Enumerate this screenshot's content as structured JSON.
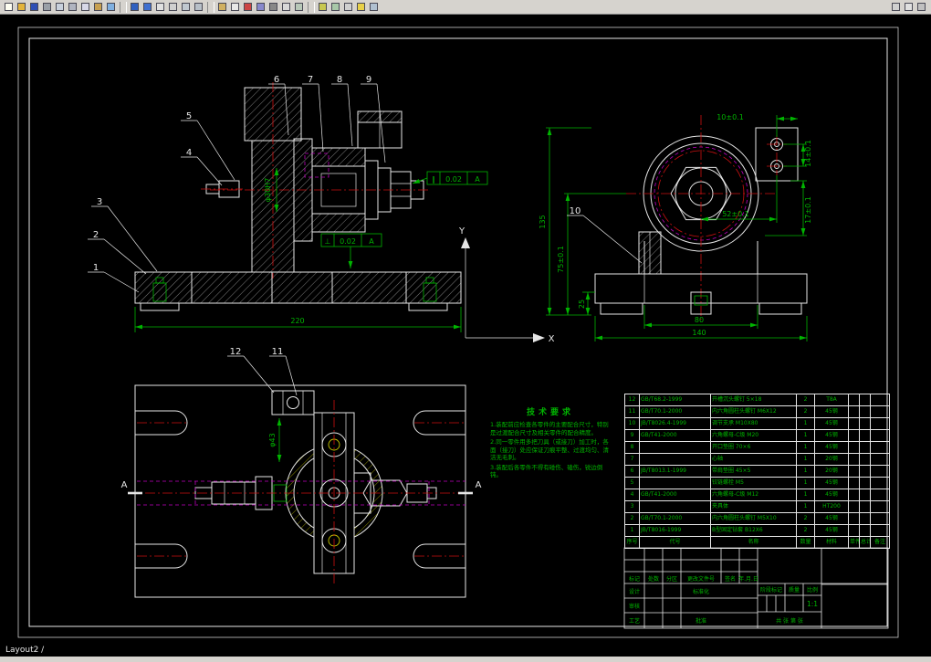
{
  "window": {
    "statusbar_tab": "Layout2 /"
  },
  "toolbar": {
    "groups": [
      {
        "icons": [
          {
            "name": "new-icon",
            "color": "#fdfdf0"
          },
          {
            "name": "open-icon",
            "color": "#e3b43c"
          },
          {
            "name": "save-icon",
            "color": "#2f4fb4"
          },
          {
            "name": "print-icon",
            "color": "#9aa0a8"
          },
          {
            "name": "print-preview-icon",
            "color": "#c8d0dc"
          },
          {
            "name": "cut-icon",
            "color": "#b0b4c0"
          },
          {
            "name": "copy-icon",
            "color": "#d8d8e8"
          },
          {
            "name": "paste-icon",
            "color": "#c8a050"
          },
          {
            "name": "match-properties-icon",
            "color": "#80b0e0"
          }
        ]
      },
      {
        "icons": [
          {
            "name": "undo-icon",
            "color": "#3060c0"
          },
          {
            "name": "redo-icon",
            "color": "#4070d0"
          },
          {
            "name": "pan-icon",
            "color": "#e0e0e0"
          },
          {
            "name": "zoom-realtime-icon",
            "color": "#d0d0d0"
          },
          {
            "name": "zoom-window-icon",
            "color": "#c0c8d0"
          },
          {
            "name": "zoom-previous-icon",
            "color": "#b8c0c8"
          }
        ]
      },
      {
        "icons": [
          {
            "name": "layers-icon",
            "color": "#d0b060"
          },
          {
            "name": "layer-control-icon",
            "color": "#e8e8e8"
          },
          {
            "name": "color-control-icon",
            "color": "#cc4444"
          },
          {
            "name": "linetype-icon",
            "color": "#8888cc"
          },
          {
            "name": "lineweight-icon",
            "color": "#888888"
          },
          {
            "name": "text-style-icon",
            "color": "#d8d8d8"
          },
          {
            "name": "dim-style-icon",
            "color": "#b8c8b8"
          }
        ]
      },
      {
        "icons": [
          {
            "name": "distance-icon",
            "color": "#c8c850"
          },
          {
            "name": "area-icon",
            "color": "#a8c8a8"
          },
          {
            "name": "list-icon",
            "color": "#d0d0d0"
          },
          {
            "name": "help-icon",
            "color": "#e8d048"
          },
          {
            "name": "properties-icon",
            "color": "#b0c0d0"
          }
        ]
      }
    ],
    "right_icons": [
      {
        "name": "model-space-icon",
        "color": "#d0d0d0"
      },
      {
        "name": "paper-space-icon",
        "color": "#e0e0e0"
      },
      {
        "name": "ucs-icon",
        "color": "#c0c0c0"
      }
    ]
  },
  "main_view": {
    "callouts": [
      "1",
      "2",
      "3",
      "4",
      "5",
      "6",
      "7",
      "8",
      "9"
    ],
    "dim_220": "220",
    "dim_phi30": "φ30H7",
    "fcf_parallel": {
      "symbol": "∥",
      "tolerance": "0.02",
      "datum": "A"
    },
    "fcf_perp": {
      "symbol": "⊥",
      "tolerance": "0.02",
      "datum": "A"
    },
    "axis_y": "Y",
    "axis_x": "X"
  },
  "front_view": {
    "callout_10": "10",
    "dim_135": "135",
    "dim_75": "75±0.1",
    "dim_25": "25",
    "dim_80": "80",
    "dim_140": "140",
    "dim_10": "10±0.1",
    "dim_14": "14±0.1",
    "dim_17": "17±0.1",
    "dim_52": "52±0.1"
  },
  "plan_view": {
    "callout_11": "11",
    "callout_12": "12",
    "dim_phi43": "φ43",
    "section_label_left": "A",
    "section_label_right": "A"
  },
  "tech_requirements": {
    "title": "技术要求",
    "items": [
      "1.装配前应检查各零件的主要配合尺寸，特别是过渡配合尺寸及相关零件的配合精度。",
      "2.同一零件用多把刀具（或接刀）加工时，各面（接刀）处应保证刀痕平整、过渡均匀、清洁无毛刺。",
      "3.装配后各零件不得有碰伤、磕伤，锐边倒钝。"
    ]
  },
  "bom": {
    "headers": [
      "序号",
      "代号",
      "名称",
      "数量",
      "材料",
      "单件",
      "总计",
      "备注"
    ],
    "rows": [
      [
        "12",
        "GB/T68.2-1999",
        "开槽沉头螺钉 5×18",
        "2",
        "T8A",
        "",
        "",
        ""
      ],
      [
        "11",
        "GB/T70.1-2000",
        "内六角圆柱头螺钉 M6X12",
        "2",
        "45钢",
        "",
        "",
        ""
      ],
      [
        "10",
        "JB/T8026.4-1999",
        "调节支承 M10X80",
        "1",
        "45钢",
        "",
        "",
        ""
      ],
      [
        "9",
        "GB/T41-2000",
        "六角螺母-C级 M20",
        "1",
        "45钢",
        "",
        "",
        ""
      ],
      [
        "8",
        "",
        "开口垫圈 70×6",
        "1",
        "45钢",
        "",
        "",
        ""
      ],
      [
        "7",
        "",
        "心轴",
        "1",
        "20钢",
        "",
        "",
        ""
      ],
      [
        "6",
        "JB/T8013.1-1999",
        "带肩垫圈 45×5",
        "1",
        "20钢",
        "",
        "",
        ""
      ],
      [
        "5",
        "",
        "铰链螺栓 M5",
        "1",
        "45钢",
        "",
        "",
        ""
      ],
      [
        "4",
        "GB/T41-2000",
        "六角螺母-C级 M12",
        "1",
        "45钢",
        "",
        "",
        ""
      ],
      [
        "3",
        "",
        "夹具体",
        "1",
        "HT200",
        "",
        "",
        ""
      ],
      [
        "2",
        "GB/T70.1-2000",
        "内六角圆柱头螺钉 M5X10",
        "2",
        "45钢",
        "",
        "",
        ""
      ],
      [
        "1",
        "JB/T8016-1999",
        "B型固定钻套 B12X6",
        "2",
        "45钢",
        "",
        "",
        ""
      ]
    ]
  },
  "title_block": {
    "revision_headers": [
      "标记",
      "处数",
      "分区",
      "更改文件号",
      "签名",
      "年.月.日"
    ],
    "role_design": "设计",
    "role_check": "审核",
    "role_process": "工艺",
    "role_approve": "批准",
    "role_standard": "标准化",
    "stage_label": "阶段标记",
    "mass_label": "质量",
    "scale_label": "比例",
    "scale_value": "1:1",
    "sheet_label": "共 张 第 张"
  }
}
